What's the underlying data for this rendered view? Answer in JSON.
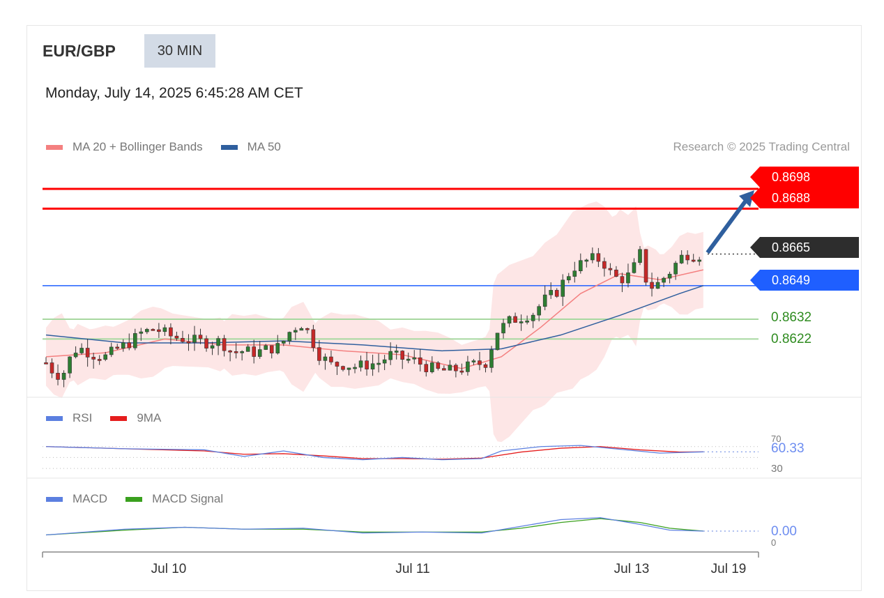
{
  "header": {
    "symbol": "EUR/GBP",
    "timeframe": "30 MIN",
    "datetime": "Monday, July 14, 2025 6:45:28 AM CET"
  },
  "legend_main": [
    {
      "label": "MA 20 + Bollinger Bands",
      "color": "#f48080"
    },
    {
      "label": "MA 50",
      "color": "#2f5f9e"
    }
  ],
  "credit": "Research © 2025 Trading Central",
  "levels": {
    "resistance": [
      "0.8698",
      "0.8688"
    ],
    "last": "0.8665",
    "pivot": "0.8649",
    "support": [
      "0.8632",
      "0.8622"
    ]
  },
  "legend_rsi": [
    {
      "label": "RSI",
      "color": "#5b7fe0"
    },
    {
      "label": "9MA",
      "color": "#e51d1d"
    }
  ],
  "rsi": {
    "value": "60.33",
    "upper": "70",
    "lower": "30"
  },
  "legend_macd": [
    {
      "label": "MACD",
      "color": "#5b7fe0"
    },
    {
      "label": "MACD Signal",
      "color": "#3aa01e"
    }
  ],
  "macd": {
    "value": "0.00",
    "zero": "0"
  },
  "x_labels": [
    "Jul 10",
    "Jul 11",
    "Jul 13",
    "Jul 19"
  ],
  "colors": {
    "resistance": "#ff0000",
    "pivot": "#1f5fff",
    "support": "#a7d8a0",
    "up_candle": "#2e7d32",
    "down_candle": "#c62828",
    "band_fill": "#fde2e2",
    "arrow": "#2f5f9e"
  },
  "chart_data": {
    "type": "candlestick",
    "title": "EUR/GBP 30 MIN",
    "y_range": [
      0.8596,
      0.8704
    ],
    "horizontal_levels": [
      0.8698,
      0.8688,
      0.8649,
      0.8632,
      0.8622
    ],
    "last_price": 0.8665,
    "x_ticks": [
      "Jul 10",
      "Jul 11",
      "Jul 13",
      "Jul 19"
    ],
    "close_path": [
      [
        0,
        0.861
      ],
      [
        4,
        0.8605
      ],
      [
        8,
        0.8603
      ],
      [
        12,
        0.8612
      ],
      [
        16,
        0.8618
      ],
      [
        20,
        0.8616
      ],
      [
        24,
        0.8614
      ],
      [
        30,
        0.8613
      ],
      [
        36,
        0.8617
      ],
      [
        42,
        0.862
      ],
      [
        48,
        0.8625
      ],
      [
        54,
        0.8627
      ],
      [
        58,
        0.8626
      ],
      [
        64,
        0.8623
      ],
      [
        70,
        0.8622
      ],
      [
        76,
        0.8621
      ],
      [
        82,
        0.862
      ],
      [
        88,
        0.8621
      ],
      [
        94,
        0.8615
      ],
      [
        100,
        0.8616
      ],
      [
        106,
        0.8615
      ],
      [
        112,
        0.8617
      ],
      [
        118,
        0.8618
      ],
      [
        124,
        0.8627
      ],
      [
        130,
        0.863
      ],
      [
        132,
        0.8626
      ],
      [
        138,
        0.8614
      ],
      [
        144,
        0.8609
      ],
      [
        150,
        0.8609
      ],
      [
        156,
        0.8608
      ],
      [
        162,
        0.8609
      ],
      [
        168,
        0.861
      ],
      [
        174,
        0.8614
      ],
      [
        180,
        0.8612
      ],
      [
        186,
        0.8611
      ],
      [
        192,
        0.8608
      ],
      [
        198,
        0.8606
      ],
      [
        204,
        0.8606
      ],
      [
        210,
        0.8607
      ],
      [
        216,
        0.8609
      ],
      [
        222,
        0.861
      ],
      [
        228,
        0.8626
      ],
      [
        234,
        0.8631
      ],
      [
        240,
        0.8633
      ],
      [
        246,
        0.8635
      ],
      [
        252,
        0.8642
      ],
      [
        258,
        0.8646
      ],
      [
        262,
        0.8652
      ],
      [
        266,
        0.8658
      ],
      [
        270,
        0.866
      ],
      [
        274,
        0.8662
      ],
      [
        278,
        0.8663
      ],
      [
        282,
        0.866
      ],
      [
        286,
        0.8654
      ],
      [
        290,
        0.8652
      ],
      [
        294,
        0.8654
      ],
      [
        298,
        0.866
      ],
      [
        300,
        0.8665
      ],
      [
        304,
        0.8648
      ],
      [
        308,
        0.8649
      ],
      [
        312,
        0.8653
      ],
      [
        316,
        0.8657
      ],
      [
        320,
        0.8663
      ],
      [
        324,
        0.8665
      ],
      [
        328,
        0.8664
      ],
      [
        332,
        0.8665
      ]
    ],
    "ma20": [
      [
        0,
        0.8613
      ],
      [
        30,
        0.8615
      ],
      [
        60,
        0.8622
      ],
      [
        90,
        0.8619
      ],
      [
        120,
        0.8619
      ],
      [
        150,
        0.8616
      ],
      [
        180,
        0.8614
      ],
      [
        210,
        0.8607
      ],
      [
        230,
        0.8613
      ],
      [
        250,
        0.8628
      ],
      [
        270,
        0.8645
      ],
      [
        290,
        0.8655
      ],
      [
        310,
        0.8652
      ],
      [
        332,
        0.8657
      ]
    ],
    "ma50": [
      [
        0,
        0.8624
      ],
      [
        40,
        0.862
      ],
      [
        80,
        0.862
      ],
      [
        120,
        0.8621
      ],
      [
        160,
        0.8619
      ],
      [
        200,
        0.8616
      ],
      [
        230,
        0.8617
      ],
      [
        260,
        0.8624
      ],
      [
        290,
        0.8634
      ],
      [
        320,
        0.8645
      ],
      [
        332,
        0.8649
      ]
    ],
    "rsi_series": [
      [
        0,
        70
      ],
      [
        40,
        66
      ],
      [
        80,
        64
      ],
      [
        100,
        52
      ],
      [
        120,
        62
      ],
      [
        140,
        50
      ],
      [
        160,
        46
      ],
      [
        180,
        50
      ],
      [
        200,
        46
      ],
      [
        220,
        48
      ],
      [
        230,
        62
      ],
      [
        250,
        70
      ],
      [
        270,
        72
      ],
      [
        290,
        65
      ],
      [
        310,
        58
      ],
      [
        332,
        60.33
      ]
    ],
    "rsi_ma": [
      [
        0,
        70
      ],
      [
        40,
        66
      ],
      [
        80,
        62
      ],
      [
        100,
        56
      ],
      [
        120,
        57
      ],
      [
        140,
        53
      ],
      [
        160,
        48
      ],
      [
        180,
        48
      ],
      [
        200,
        47
      ],
      [
        220,
        49
      ],
      [
        240,
        60
      ],
      [
        260,
        67
      ],
      [
        280,
        70
      ],
      [
        300,
        64
      ],
      [
        320,
        60
      ],
      [
        332,
        60.33
      ]
    ],
    "macd_series": [
      [
        0,
        -0.0004
      ],
      [
        40,
        0.0002
      ],
      [
        70,
        0.0004
      ],
      [
        100,
        0.0002
      ],
      [
        130,
        0.0003
      ],
      [
        160,
        -0.0002
      ],
      [
        190,
        -0.0001
      ],
      [
        220,
        -0.0002
      ],
      [
        240,
        0.0005
      ],
      [
        260,
        0.0012
      ],
      [
        280,
        0.0014
      ],
      [
        300,
        0.0007
      ],
      [
        315,
        0.0001
      ],
      [
        332,
        0.0
      ]
    ],
    "macd_signal": [
      [
        0,
        -0.0004
      ],
      [
        40,
        0.0001
      ],
      [
        70,
        0.0004
      ],
      [
        100,
        0.0002
      ],
      [
        130,
        0.0002
      ],
      [
        160,
        -0.0001
      ],
      [
        190,
        -0.0001
      ],
      [
        220,
        -0.0001
      ],
      [
        240,
        0.0003
      ],
      [
        260,
        0.0009
      ],
      [
        280,
        0.0013
      ],
      [
        300,
        0.0009
      ],
      [
        315,
        0.0003
      ],
      [
        332,
        0.0
      ]
    ]
  }
}
